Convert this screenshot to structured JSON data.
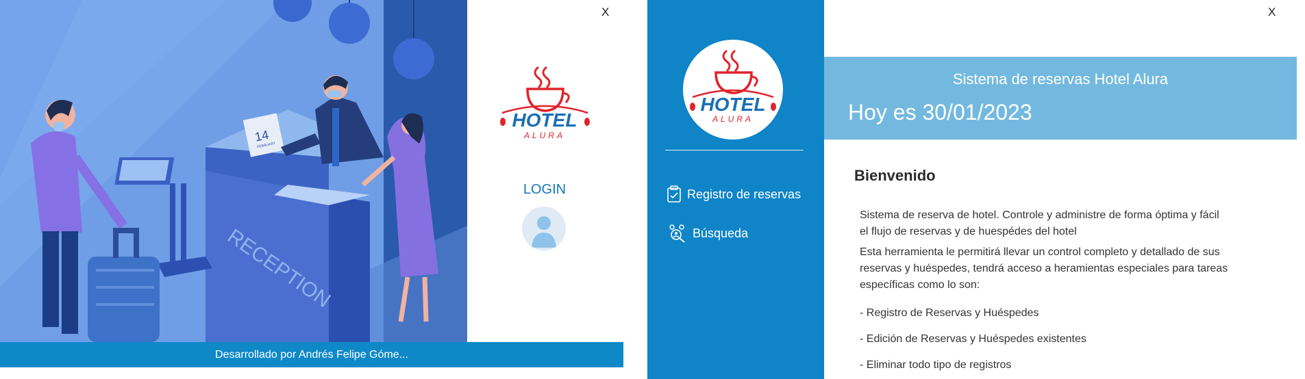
{
  "login_window": {
    "close_label": "X",
    "logo": {
      "main_text": "HOTEL",
      "sub_text": "ALURA"
    },
    "illustration": {
      "desk_text": "RECEPTION",
      "calendar_day": "14",
      "calendar_month": "FEBRUARY"
    },
    "login_label": "LOGIN",
    "footer_text": "Desarrollado por Andrés Felipe Góme..."
  },
  "menu_window": {
    "close_label": "X",
    "logo": {
      "main_text": "HOTEL",
      "sub_text": "ALURA"
    },
    "sidebar": {
      "items": [
        {
          "label": "Registro de reservas",
          "icon": "reservation-register-icon"
        },
        {
          "label": "Búsqueda",
          "icon": "search-people-icon"
        }
      ]
    },
    "banner": {
      "title": "Sistema de reservas Hotel Alura",
      "date": "Hoy es 30/01/2023"
    },
    "content": {
      "heading": "Bienvenido",
      "paragraph1_line1": "Sistema de reserva de hotel. Controle y administre de forma óptima y fácil",
      "paragraph1_line2": "el flujo de reservas y de huespédes del hotel",
      "paragraph2_line1": "Esta herramienta le permitirá llevar un control completo y detallado de sus",
      "paragraph2_line2": "reservas y huéspedes, tendrá acceso a heramientas especiales para tareas",
      "paragraph2_line3": "específicas como lo son:",
      "bullets": [
        "- Registro de Reservas y Huéspedes",
        "- Edición de Reservas y Huéspedes existentes",
        "- Eliminar todo tipo de registros"
      ]
    }
  },
  "colors": {
    "primary_blue": "#0f84c7",
    "banner_blue": "#73b9df",
    "logo_red": "#e0232b",
    "logo_blue": "#1a6fb5",
    "login_blue": "#1577b8"
  }
}
